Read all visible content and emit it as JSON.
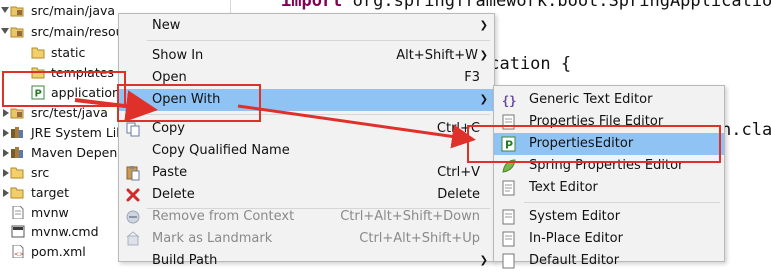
{
  "tree": {
    "items": [
      {
        "label": "src/main/java",
        "icon": "package-folder-icon",
        "expanded": true
      },
      {
        "label": "src/main/resou",
        "icon": "package-folder-icon",
        "expanded": true
      },
      {
        "label": "static",
        "icon": "folder-icon",
        "expanded": false
      },
      {
        "label": "templates",
        "icon": "folder-icon",
        "expanded": false
      },
      {
        "label": "application.",
        "icon": "properties-file-icon",
        "expanded": false
      },
      {
        "label": "src/test/java",
        "icon": "package-folder-icon",
        "expanded": false
      },
      {
        "label": "JRE System Lib",
        "icon": "library-icon",
        "expanded": false
      },
      {
        "label": "Maven Depenc",
        "icon": "library-icon",
        "expanded": false
      },
      {
        "label": "src",
        "icon": "folder-icon",
        "expanded": false
      },
      {
        "label": "target",
        "icon": "folder-icon",
        "expanded": false
      },
      {
        "label": "mvnw",
        "icon": "file-icon",
        "expanded": false
      },
      {
        "label": "mvnw.cmd",
        "icon": "cmd-file-icon",
        "expanded": false
      },
      {
        "label": "pom.xml",
        "icon": "xml-file-icon",
        "expanded": false
      }
    ]
  },
  "editor": {
    "line1_keyword": "import",
    "line1_rest": " org.springframework.boot.SpringApplicatior",
    "line2": "ication {",
    "line3_tail": "n.cla"
  },
  "context_menu": {
    "items": [
      {
        "label": "New",
        "shortcut": "",
        "submenu": true
      },
      {
        "label": "Show In",
        "shortcut": "Alt+Shift+W",
        "submenu": true
      },
      {
        "label": "Open",
        "shortcut": "F3",
        "submenu": false
      },
      {
        "label": "Open With",
        "shortcut": "",
        "submenu": true
      },
      {
        "label": "Copy",
        "shortcut": "Ctrl+C",
        "submenu": false
      },
      {
        "label": "Copy Qualified Name",
        "shortcut": "",
        "submenu": false
      },
      {
        "label": "Paste",
        "shortcut": "Ctrl+V",
        "submenu": false
      },
      {
        "label": "Delete",
        "shortcut": "Delete",
        "submenu": false
      },
      {
        "label": "Remove from Context",
        "shortcut": "Ctrl+Alt+Shift+Down",
        "submenu": false
      },
      {
        "label": "Mark as Landmark",
        "shortcut": "Ctrl+Alt+Shift+Up",
        "submenu": false
      },
      {
        "label": "Build Path",
        "shortcut": "",
        "submenu": true
      }
    ]
  },
  "open_with_submenu": {
    "items": [
      {
        "label": "Generic Text Editor"
      },
      {
        "label": "Properties File Editor"
      },
      {
        "label": "PropertiesEditor"
      },
      {
        "label": "Spring Properties Editor"
      },
      {
        "label": "Text Editor"
      },
      {
        "label": "System Editor"
      },
      {
        "label": "In-Place Editor"
      },
      {
        "label": "Default Editor"
      }
    ]
  },
  "colors": {
    "highlight": "#8fc3f3",
    "annotation_red": "#e0302a",
    "keyword": "#7f0055"
  }
}
